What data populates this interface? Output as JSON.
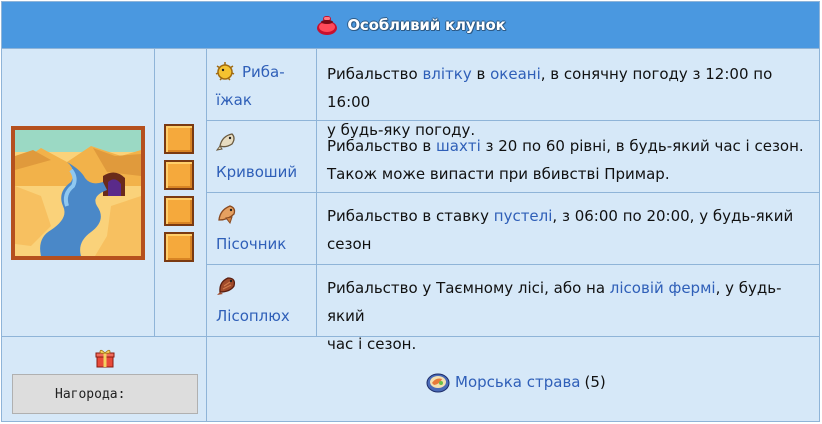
{
  "bundle": {
    "title": "Особливий клунок",
    "title_icon": "red-bundle-icon",
    "scene_icon": "desert-river-scene",
    "slot_count": 4,
    "items": [
      {
        "name_line1": "Риба-",
        "name_line2": "їжак",
        "icon": "pufferfish-icon",
        "desc": {
          "p1": "Рибальство ",
          "l1": "влітку",
          "p2": " в ",
          "l2": "океані",
          "p3": ", в сонячну погоду з 12:00 по 16:00",
          "line2": "у будь-яку погоду."
        }
      },
      {
        "name": "Кривоший",
        "icon": "ghostfish-icon",
        "desc": {
          "p1": "Рибальство в ",
          "l1": "шахті",
          "p2": " з 20 по 60 рівні, в будь-який час і сезон.",
          "line2": "Також може випасти при вбивстві Примар."
        }
      },
      {
        "name": "Пісочник",
        "icon": "sandfish-icon",
        "desc": {
          "p1": "Рибальство в ставку ",
          "l1": "пустелі",
          "p2": ", з 06:00 по 20:00, у будь-який",
          "line2": "сезон"
        }
      },
      {
        "name": "Лісоплюх",
        "icon": "woodskip-icon",
        "desc": {
          "p1": "Рибальство у Таємному лісі, або на ",
          "l1": "лісовій фермі",
          "p2": ", у будь-який",
          "line2": "час і сезон."
        }
      }
    ],
    "reward": {
      "label": "Нагорода:",
      "gift_icon": "gift-icon",
      "item_icon": "seafoam-dish-icon",
      "item_name": "Морська страва",
      "item_qty": "(5)"
    },
    "colors": {
      "header": "#4a98e0",
      "panel": "#d6e8f8",
      "border": "#8fb4d8",
      "link": "#2f5fb8",
      "slot": "#f5a93c"
    }
  }
}
